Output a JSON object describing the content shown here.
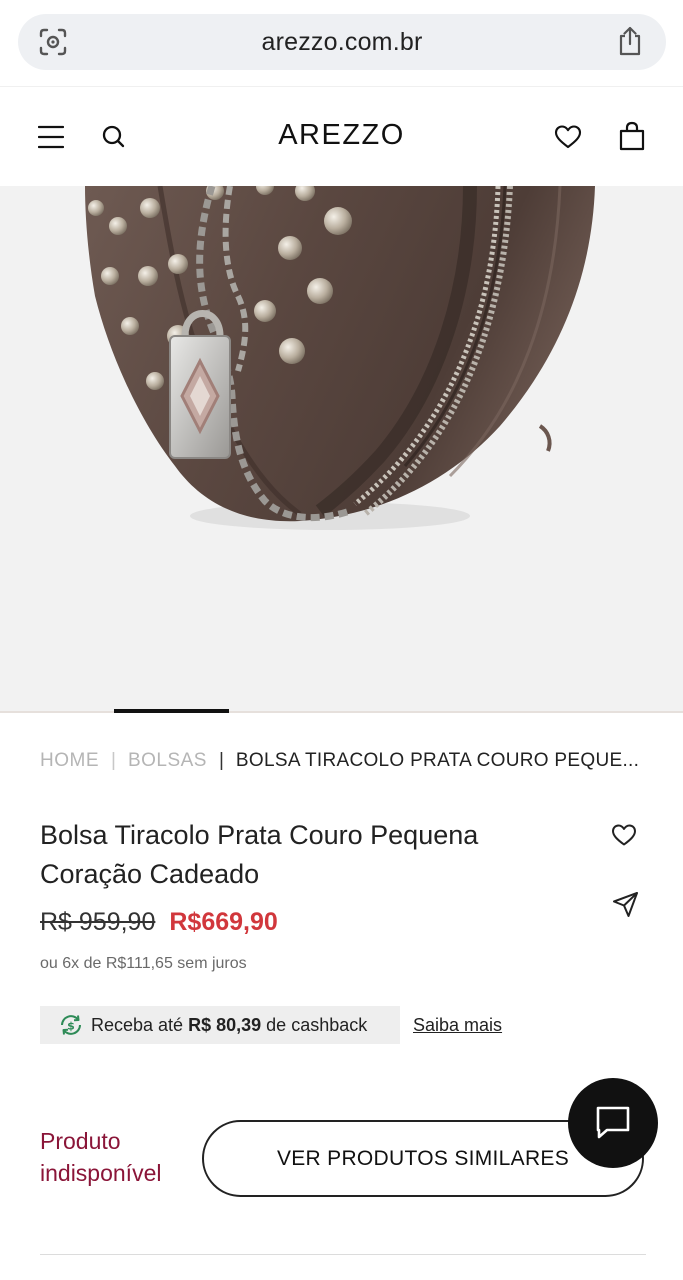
{
  "browser": {
    "url": "arezzo.com.br"
  },
  "header": {
    "logo": "AREZZO"
  },
  "breadcrumb": {
    "home": "HOME",
    "separator": "|",
    "category": "BOLSAS",
    "current": "BOLSA TIRACOLO PRATA COURO PEQUE..."
  },
  "product": {
    "title": "Bolsa Tiracolo Prata Couro Pequena Coração Cadeado",
    "price_old": "R$ 959,90",
    "price_new": "R$669,90",
    "installments": "ou 6x de R$111,65 sem juros",
    "cashback_prefix": "Receba até",
    "cashback_amount": "R$ 80,39",
    "cashback_suffix": "de cashback",
    "cashback_link": "Saiba mais",
    "status": "Produto indisponível",
    "similar_button": "VER PRODUTOS SIMILARES"
  },
  "carousel": {
    "active_index": 1,
    "count": 6
  },
  "colors": {
    "price_sale": "#d1373c",
    "unavailable": "#8a1538",
    "bag_leather": "#5e4a43",
    "chat_bg": "#111111"
  },
  "icons": [
    "screenshot-icon",
    "share-icon",
    "menu-icon",
    "search-icon",
    "heart-icon",
    "bag-icon",
    "wishlist-icon",
    "send-icon",
    "cashback-icon",
    "chat-icon"
  ]
}
